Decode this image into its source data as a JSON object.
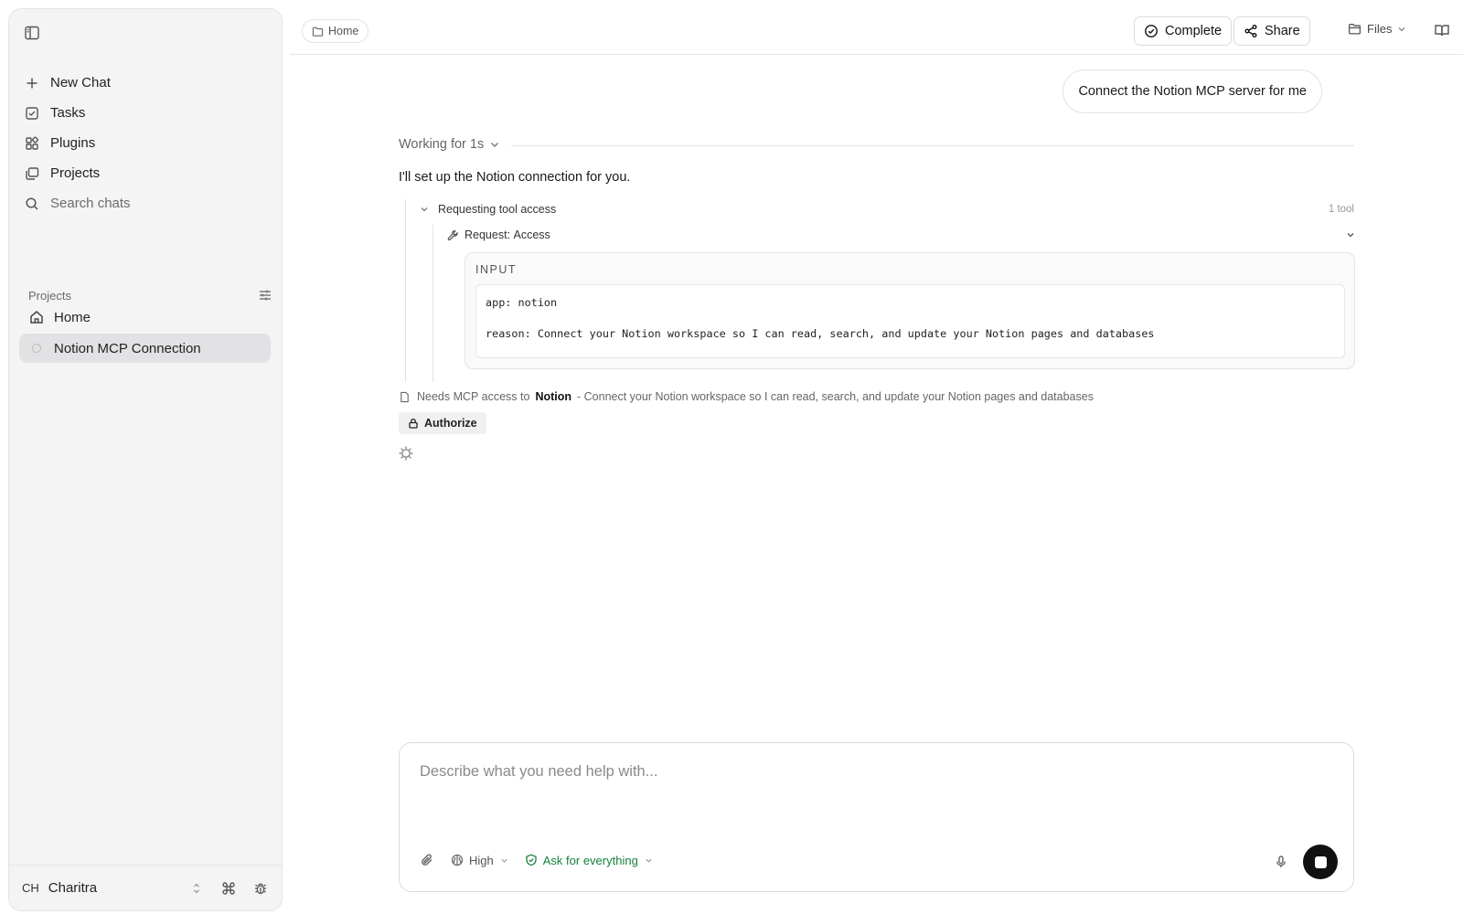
{
  "sidebar": {
    "nav": [
      {
        "label": "New Chat",
        "icon": "plus-icon"
      },
      {
        "label": "Tasks",
        "icon": "tasks-icon"
      },
      {
        "label": "Plugins",
        "icon": "plugins-icon"
      },
      {
        "label": "Projects",
        "icon": "projects-icon"
      }
    ],
    "search_label": "Search chats",
    "projects_heading": "Projects",
    "projects": [
      {
        "label": "Home",
        "icon": "home-icon"
      },
      {
        "label": "Notion MCP Connection",
        "icon": "loading-dot-icon",
        "active": true
      }
    ],
    "user": {
      "initials": "CH",
      "name": "Charitra"
    }
  },
  "header": {
    "breadcrumb": "Home",
    "complete_label": "Complete",
    "share_label": "Share",
    "files_label": "Files"
  },
  "chat": {
    "user_message": "Connect the Notion MCP server for me",
    "working_label": "Working for 1s",
    "reply": "I'll set up the Notion connection for you.",
    "tool_group": {
      "title": "Requesting tool access",
      "count": "1 tool",
      "request_prefix": "Request",
      "request_name": "Access",
      "input_label": "INPUT",
      "input_lines": [
        "app: notion",
        "reason: Connect your Notion workspace so I can read, search, and update your Notion pages and databases"
      ]
    },
    "needs": {
      "prefix": "Needs MCP access to",
      "app": "Notion",
      "suffix": "- Connect your Notion workspace so I can read, search, and update your Notion pages and databases"
    },
    "authorize_label": "Authorize"
  },
  "composer": {
    "placeholder": "Describe what you need help with...",
    "effort_label": "High",
    "permission_label": "Ask for everything"
  },
  "colors": {
    "accent_green": "#15803d",
    "active_item_bg": "#e2e2e5",
    "stop_button": "#111111"
  }
}
